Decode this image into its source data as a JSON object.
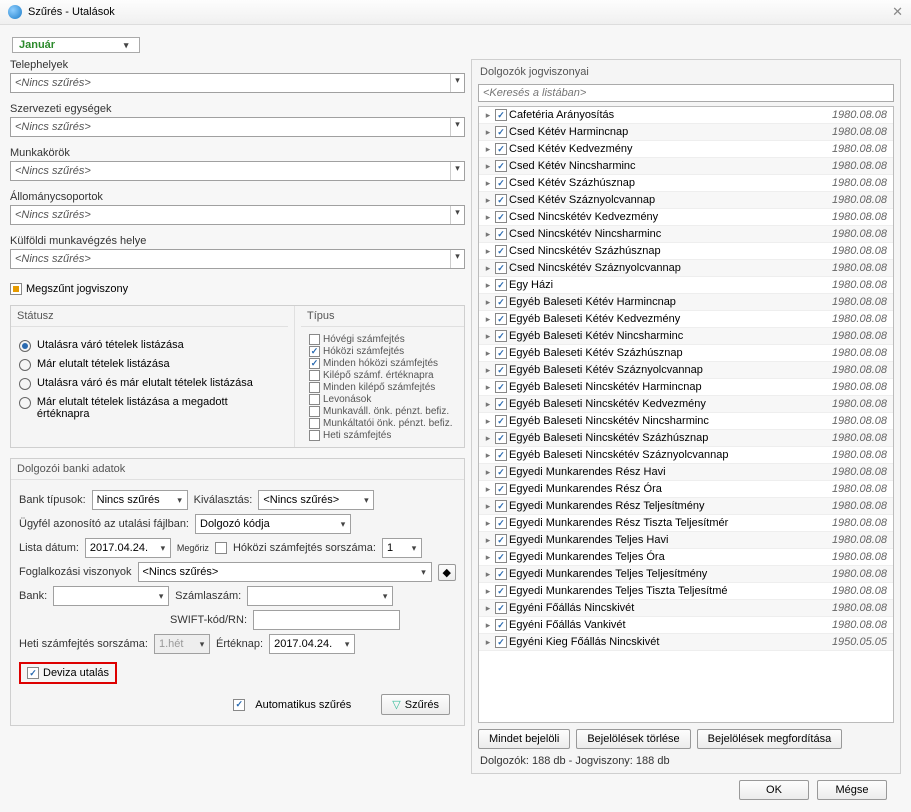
{
  "window": {
    "title": "Szűrés - Utalások"
  },
  "month": {
    "value": "Január"
  },
  "filters": {
    "telephelyek": {
      "label": "Telephelyek",
      "value": "<Nincs szűrés>"
    },
    "szervezeti": {
      "label": "Szervezeti egységek",
      "value": "<Nincs szűrés>"
    },
    "munkakorok": {
      "label": "Munkakörök",
      "value": "<Nincs szűrés>"
    },
    "allomany": {
      "label": "Állománycsoportok",
      "value": "<Nincs szűrés>"
    },
    "kulfoldi": {
      "label": "Külföldi munkavégzés helye",
      "value": "<Nincs szűrés>"
    },
    "megszunt": "Megszűnt jogviszony"
  },
  "status": {
    "title": "Státusz",
    "options": [
      "Utalásra váró tételek listázása",
      "Már elutalt tételek listázása",
      "Utalásra váró és már elutalt tételek listázása",
      "Már elutalt tételek listázása a megadott értéknapra"
    ]
  },
  "tipus": {
    "title": "Típus",
    "items": [
      {
        "label": "Hóvégi számfejtés",
        "checked": false
      },
      {
        "label": "Hóközi számfejtés",
        "checked": true
      },
      {
        "label": "Minden hóközi számfejtés",
        "checked": true
      },
      {
        "label": "Kilépő számf. értéknapra",
        "checked": false
      },
      {
        "label": "Minden kilépő számfejtés",
        "checked": false
      },
      {
        "label": "Levonások",
        "checked": false
      },
      {
        "label": "Munkaváll. önk. pénzt. befiz.",
        "checked": false
      },
      {
        "label": "Munkáltatói önk. pénzt. befiz.",
        "checked": false
      },
      {
        "label": "Heti számfejtés",
        "checked": false
      }
    ]
  },
  "bank": {
    "title": "Dolgozói banki adatok",
    "bank_tipusok_lbl": "Bank típusok:",
    "bank_tipusok_val": "Nincs szűrés",
    "kivalasztas_lbl": "Kiválasztás:",
    "kivalasztas_val": "<Nincs szűrés>",
    "ugyfel_lbl": "Ügyfél azonosító az utalási fájlban:",
    "ugyfel_val": "Dolgozó kódja",
    "lista_datum_lbl": "Lista dátum:",
    "lista_datum_val": "2017.04.24.",
    "megorz": "Megőriz",
    "hokozi_lbl": "Hóközi számfejtés sorszáma:",
    "hokozi_val": "1",
    "fogl_lbl": "Foglalkozási viszonyok",
    "fogl_val": "<Nincs szűrés>",
    "bank_lbl": "Bank:",
    "szamla_lbl": "Számlaszám:",
    "swift_lbl": "SWIFT-kód/RN:",
    "heti_lbl": "Heti számfejtés sorszáma:",
    "heti_val": "1.hét",
    "ertek_lbl": "Értéknap:",
    "ertek_val": "2017.04.24.",
    "deviza": "Deviza utalás",
    "auto": "Automatikus szűrés",
    "szures_btn": "Szűrés"
  },
  "right": {
    "title": "Dolgozók jogviszonyai",
    "search_placeholder": "<Keresés a listában>",
    "rows": [
      {
        "name": "Cafetéria Arányosítás",
        "date": "1980.08.08"
      },
      {
        "name": "Csed Kétév Harmincnap",
        "date": "1980.08.08"
      },
      {
        "name": "Csed Kétév Kedvezmény",
        "date": "1980.08.08"
      },
      {
        "name": "Csed Kétév Nincsharminc",
        "date": "1980.08.08"
      },
      {
        "name": "Csed Kétév Százhúsznap",
        "date": "1980.08.08"
      },
      {
        "name": "Csed Kétév Száznyolcvannap",
        "date": "1980.08.08"
      },
      {
        "name": "Csed Nincskétév Kedvezmény",
        "date": "1980.08.08"
      },
      {
        "name": "Csed Nincskétév Nincsharminc",
        "date": "1980.08.08"
      },
      {
        "name": "Csed Nincskétév Százhúsznap",
        "date": "1980.08.08"
      },
      {
        "name": "Csed Nincskétév Száznyolcvannap",
        "date": "1980.08.08"
      },
      {
        "name": "Egy Házi",
        "date": "1980.08.08"
      },
      {
        "name": "Egyéb Baleseti Kétév Harmincnap",
        "date": "1980.08.08"
      },
      {
        "name": "Egyéb Baleseti Kétév Kedvezmény",
        "date": "1980.08.08"
      },
      {
        "name": "Egyéb Baleseti Kétév Nincsharminc",
        "date": "1980.08.08"
      },
      {
        "name": "Egyéb Baleseti Kétév Százhúsznap",
        "date": "1980.08.08"
      },
      {
        "name": "Egyéb Baleseti Kétév Száznyolcvannap",
        "date": "1980.08.08"
      },
      {
        "name": "Egyéb Baleseti Nincskétév Harmincnap",
        "date": "1980.08.08"
      },
      {
        "name": "Egyéb Baleseti Nincskétév Kedvezmény",
        "date": "1980.08.08"
      },
      {
        "name": "Egyéb Baleseti Nincskétév Nincsharminc",
        "date": "1980.08.08"
      },
      {
        "name": "Egyéb Baleseti Nincskétév Százhúsznap",
        "date": "1980.08.08"
      },
      {
        "name": "Egyéb Baleseti Nincskétév Száznyolcvannap",
        "date": "1980.08.08"
      },
      {
        "name": "Egyedi Munkarendes Rész Havi",
        "date": "1980.08.08"
      },
      {
        "name": "Egyedi Munkarendes Rész Óra",
        "date": "1980.08.08"
      },
      {
        "name": "Egyedi Munkarendes Rész Teljesítmény",
        "date": "1980.08.08"
      },
      {
        "name": "Egyedi Munkarendes Rész Tiszta Teljesítmér",
        "date": "1980.08.08"
      },
      {
        "name": "Egyedi Munkarendes Teljes Havi",
        "date": "1980.08.08"
      },
      {
        "name": "Egyedi Munkarendes Teljes Óra",
        "date": "1980.08.08"
      },
      {
        "name": "Egyedi Munkarendes Teljes Teljesítmény",
        "date": "1980.08.08"
      },
      {
        "name": "Egyedi Munkarendes Teljes Tiszta Teljesítmé",
        "date": "1980.08.08"
      },
      {
        "name": "Egyéni Főállás Nincskivét",
        "date": "1980.08.08"
      },
      {
        "name": "Egyéni Főállás Vankivét",
        "date": "1980.08.08"
      },
      {
        "name": "Egyéni Kieg Főállás Nincskivét",
        "date": "1950.05.05"
      }
    ],
    "btns": {
      "all": "Mindet bejelöli",
      "clear": "Bejelölések törlése",
      "invert": "Bejelölések megfordítása"
    },
    "status": "Dolgozók: 188 db - Jogviszony: 188 db"
  },
  "footer": {
    "ok": "OK",
    "cancel": "Mégse"
  }
}
